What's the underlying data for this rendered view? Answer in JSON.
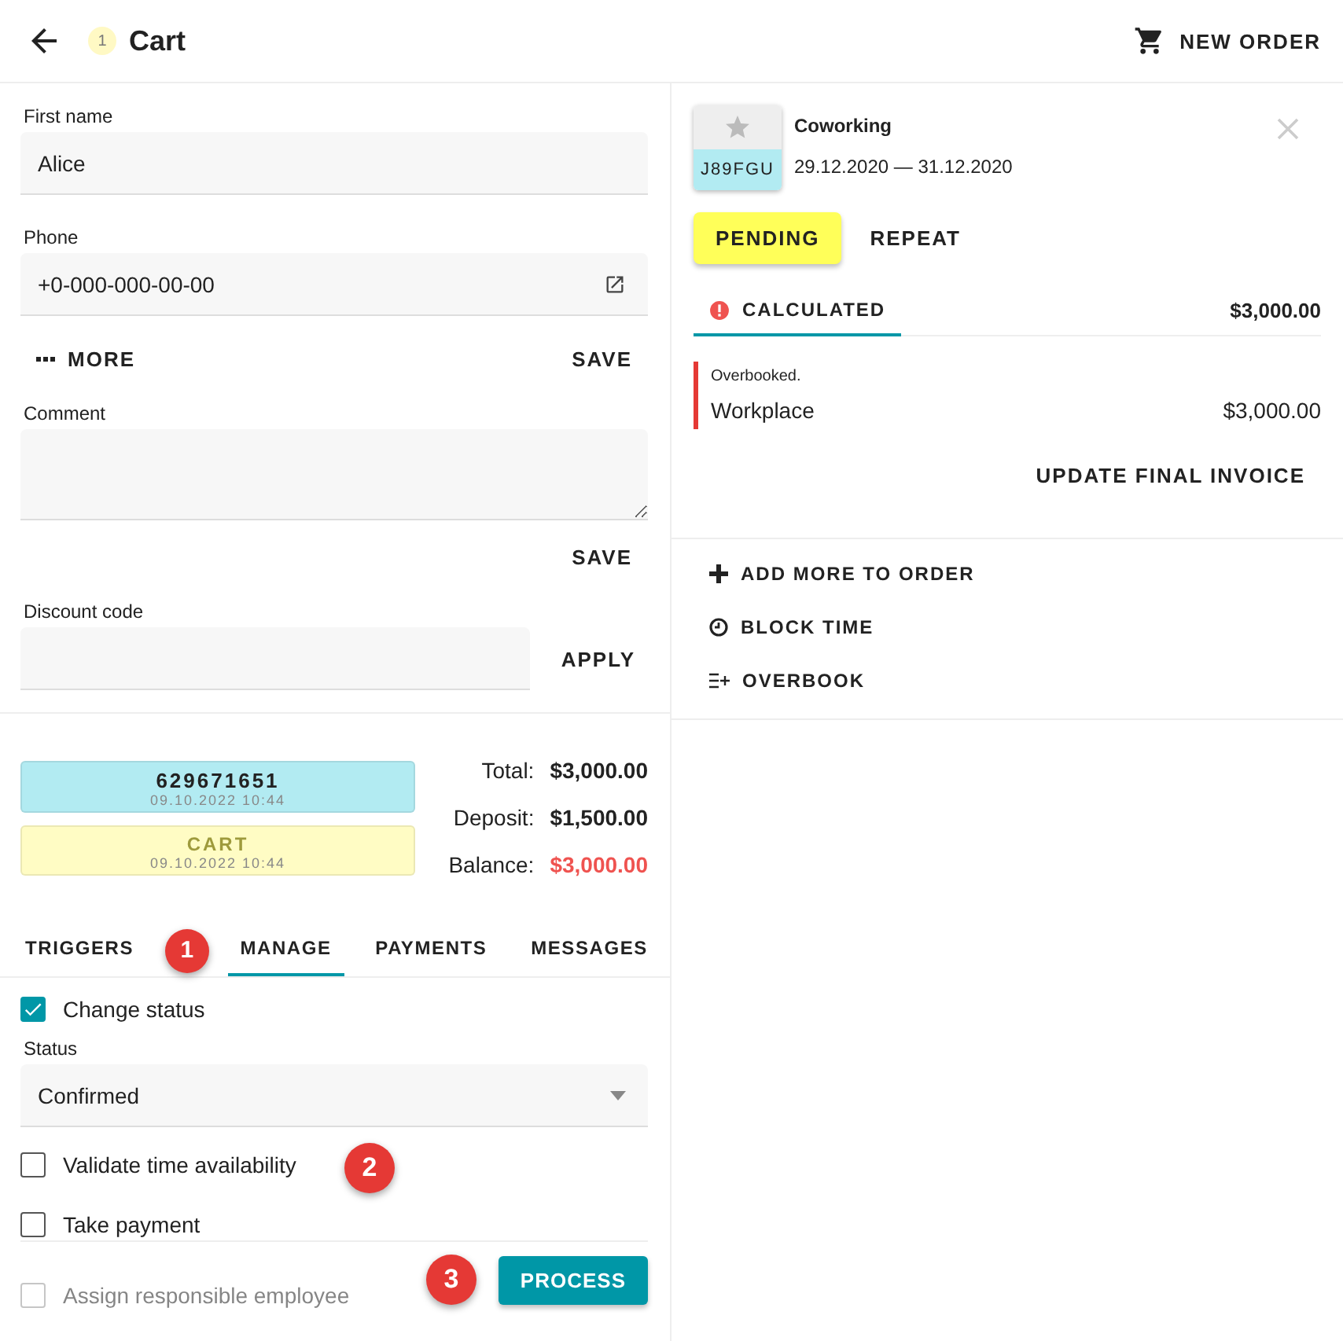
{
  "header": {
    "title": "Cart",
    "badge": "1",
    "action": "NEW ORDER"
  },
  "customer_form": {
    "fields": [
      {
        "label": "First name",
        "value": "Alice",
        "kind": "text"
      },
      {
        "label": "Phone",
        "value": "+0-000-000-00-00",
        "kind": "phone"
      }
    ],
    "more_button": "MORE",
    "save_button": "SAVE"
  },
  "comment": {
    "label": "Comment",
    "save_button": "SAVE"
  },
  "discount": {
    "label": "Discount code",
    "apply_button": "APPLY"
  },
  "status_cards": [
    {
      "title": "629671651",
      "time": "09.10.2022 10:44",
      "color": "#b2ebf2"
    },
    {
      "title": "CART",
      "time": "09.10.2022 10:44",
      "color": "#fffcc4"
    }
  ],
  "totals": [
    {
      "label": "Total:",
      "value": "$3,000.00",
      "due": false
    },
    {
      "label": "Deposit:",
      "value": "$1,500.00",
      "due": false
    },
    {
      "label": "Balance:",
      "value": "$3,000.00",
      "due": true
    }
  ],
  "tabs": [
    {
      "label": "TRIGGERS",
      "selected": false
    },
    {
      "label": "MANAGE",
      "selected": true
    },
    {
      "label": "PAYMENTS",
      "selected": false
    },
    {
      "label": "MESSAGES",
      "selected": false
    }
  ],
  "manage": {
    "change_status": {
      "label": "Change status",
      "checked": true
    },
    "status": {
      "label": "Status",
      "value": "Confirmed"
    },
    "options": [
      {
        "label": "Validate time availability",
        "checked": false,
        "disabled": false
      },
      {
        "label": "Take payment",
        "checked": false,
        "disabled": false
      },
      {
        "label": "Assign responsible employee",
        "checked": false,
        "disabled": true
      }
    ],
    "process_button": "PROCESS"
  },
  "annotations": [
    "1",
    "2",
    "3"
  ],
  "booking": {
    "thumb_code": "J89FGU",
    "name": "Coworking",
    "dates": "29.12.2020 — 31.12.2020",
    "status_button": "PENDING",
    "repeat_button": "REPEAT",
    "tab": {
      "label": "CALCULATED",
      "selected": true
    },
    "total": "$3,000.00",
    "warning": "Overbooked.",
    "items": [
      {
        "name": "Workplace",
        "price": "$3,000.00"
      }
    ],
    "update_button": "UPDATE FINAL INVOICE"
  },
  "actions": [
    {
      "label": "ADD MORE TO ORDER",
      "kind": "add"
    },
    {
      "label": "BLOCK TIME",
      "kind": "clock"
    },
    {
      "label": "OVERBOOK",
      "kind": "overbook"
    }
  ]
}
